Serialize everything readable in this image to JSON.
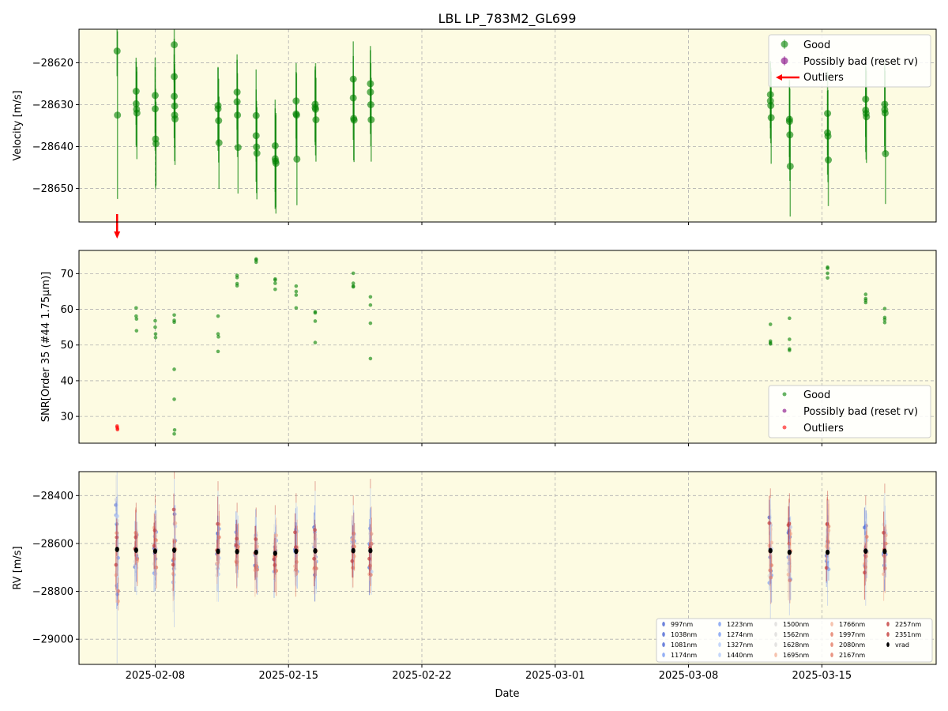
{
  "figure": {
    "title": "LBL LP_783M2_GL699",
    "xlabel": "Date",
    "x_ticks": [
      "2025-02-08",
      "2025-02-15",
      "2025-02-22",
      "2025-03-01",
      "2025-03-08",
      "2025-03-15"
    ],
    "xlim": [
      "2025-02-04",
      "2025-03-21"
    ],
    "background_color": "#fdfbe2",
    "grid": true
  },
  "colors": {
    "good": "#008000",
    "bad": "#800080",
    "outlier": "#ff0000",
    "vrad": "#000000",
    "wavelength_cmap": [
      "#4a65d4",
      "#7b9cf2",
      "#b6cdfa",
      "#dddcdb",
      "#f4b49a",
      "#e47b64",
      "#c33b3a"
    ]
  },
  "chart_data": [
    {
      "type": "scatter",
      "panel": "velocity",
      "ylabel": "Velocity [m/s]",
      "ylim": [
        -28658,
        -28612
      ],
      "yticks": [
        -28620,
        -28630,
        -28640,
        -28650
      ],
      "legend": {
        "placement": "top-right",
        "entries": [
          "Good",
          "Possibly bad (reset rv)",
          "Outliers"
        ]
      },
      "series": [
        {
          "name": "Good",
          "points": [
            {
              "x": "2025-02-06.00",
              "y": -28617.2,
              "err": 6
            },
            {
              "x": "2025-02-06.02",
              "y": -28632.5,
              "err": 20
            },
            {
              "x": "2025-02-07.00",
              "y": -28626.8,
              "err": 8
            },
            {
              "x": "2025-02-07.00",
              "y": -28629.8,
              "err": 10
            },
            {
              "x": "2025-02-07.02",
              "y": -28631.1,
              "err": 9
            },
            {
              "x": "2025-02-07.04",
              "y": -28632.0,
              "err": 11
            },
            {
              "x": "2025-02-08.00",
              "y": -28627.8,
              "err": 9
            },
            {
              "x": "2025-02-08.00",
              "y": -28631.0,
              "err": 10
            },
            {
              "x": "2025-02-08.02",
              "y": -28638.2,
              "err": 12
            },
            {
              "x": "2025-02-08.04",
              "y": -28639.3,
              "err": 10
            },
            {
              "x": "2025-02-09.00",
              "y": -28615.7,
              "err": 9
            },
            {
              "x": "2025-02-09.00",
              "y": -28623.3,
              "err": 9
            },
            {
              "x": "2025-02-09.00",
              "y": -28628.0,
              "err": 10
            },
            {
              "x": "2025-02-09.02",
              "y": -28630.3,
              "err": 10
            },
            {
              "x": "2025-02-09.02",
              "y": -28632.5,
              "err": 11
            },
            {
              "x": "2025-02-09.04",
              "y": -28633.4,
              "err": 11
            },
            {
              "x": "2025-02-11.30",
              "y": -28630.2,
              "err": 9
            },
            {
              "x": "2025-02-11.30",
              "y": -28631.0,
              "err": 10
            },
            {
              "x": "2025-02-11.33",
              "y": -28633.8,
              "err": 10
            },
            {
              "x": "2025-02-11.35",
              "y": -28639.1,
              "err": 11
            },
            {
              "x": "2025-02-12.30",
              "y": -28627.0,
              "err": 9
            },
            {
              "x": "2025-02-12.30",
              "y": -28629.3,
              "err": 10
            },
            {
              "x": "2025-02-12.32",
              "y": -28632.5,
              "err": 10
            },
            {
              "x": "2025-02-12.35",
              "y": -28640.2,
              "err": 11
            },
            {
              "x": "2025-02-13.30",
              "y": -28632.6,
              "err": 11
            },
            {
              "x": "2025-02-13.30",
              "y": -28637.4,
              "err": 11
            },
            {
              "x": "2025-02-13.32",
              "y": -28640.1,
              "err": 11
            },
            {
              "x": "2025-02-13.34",
              "y": -28641.6,
              "err": 11
            },
            {
              "x": "2025-02-14.30",
              "y": -28639.8,
              "err": 11
            },
            {
              "x": "2025-02-14.30",
              "y": -28642.9,
              "err": 12
            },
            {
              "x": "2025-02-14.32",
              "y": -28643.5,
              "err": 11
            },
            {
              "x": "2025-02-14.34",
              "y": -28644.0,
              "err": 12
            },
            {
              "x": "2025-02-15.40",
              "y": -28629.1,
              "err": 9
            },
            {
              "x": "2025-02-15.40",
              "y": -28632.2,
              "err": 10
            },
            {
              "x": "2025-02-15.42",
              "y": -28632.5,
              "err": 10
            },
            {
              "x": "2025-02-15.44",
              "y": -28643.0,
              "err": 11
            },
            {
              "x": "2025-02-16.40",
              "y": -28629.9,
              "err": 9
            },
            {
              "x": "2025-02-16.40",
              "y": -28630.7,
              "err": 9
            },
            {
              "x": "2025-02-16.42",
              "y": -28631.1,
              "err": 11
            },
            {
              "x": "2025-02-16.44",
              "y": -28633.6,
              "err": 10
            },
            {
              "x": "2025-02-18.40",
              "y": -28623.9,
              "err": 9
            },
            {
              "x": "2025-02-18.40",
              "y": -28628.4,
              "err": 10
            },
            {
              "x": "2025-02-18.42",
              "y": -28633.3,
              "err": 10
            },
            {
              "x": "2025-02-18.44",
              "y": -28633.7,
              "err": 10
            },
            {
              "x": "2025-02-19.30",
              "y": -28625.0,
              "err": 9
            },
            {
              "x": "2025-02-19.30",
              "y": -28627.0,
              "err": 10
            },
            {
              "x": "2025-02-19.32",
              "y": -28630.0,
              "err": 10
            },
            {
              "x": "2025-02-19.34",
              "y": -28633.6,
              "err": 10
            },
            {
              "x": "2025-03-12.30",
              "y": -28627.6,
              "err": 8
            },
            {
              "x": "2025-03-12.30",
              "y": -28629.1,
              "err": 9
            },
            {
              "x": "2025-03-12.32",
              "y": -28630.2,
              "err": 9
            },
            {
              "x": "2025-03-12.34",
              "y": -28633.1,
              "err": 11
            },
            {
              "x": "2025-03-13.30",
              "y": -28633.5,
              "err": 9
            },
            {
              "x": "2025-03-13.30",
              "y": -28634.0,
              "err": 10
            },
            {
              "x": "2025-03-13.32",
              "y": -28637.2,
              "err": 11
            },
            {
              "x": "2025-03-13.34",
              "y": -28644.7,
              "err": 12
            },
            {
              "x": "2025-03-15.30",
              "y": -28632.1,
              "err": 10
            },
            {
              "x": "2025-03-15.30",
              "y": -28636.7,
              "err": 10
            },
            {
              "x": "2025-03-15.32",
              "y": -28637.5,
              "err": 11
            },
            {
              "x": "2025-03-15.34",
              "y": -28643.2,
              "err": 11
            },
            {
              "x": "2025-03-17.30",
              "y": -28628.7,
              "err": 9
            },
            {
              "x": "2025-03-17.30",
              "y": -28631.3,
              "err": 10
            },
            {
              "x": "2025-03-17.32",
              "y": -28632.1,
              "err": 11
            },
            {
              "x": "2025-03-17.34",
              "y": -28632.9,
              "err": 11
            },
            {
              "x": "2025-03-18.30",
              "y": -28629.9,
              "err": 10
            },
            {
              "x": "2025-03-18.30",
              "y": -28631.2,
              "err": 10
            },
            {
              "x": "2025-03-18.32",
              "y": -28632.0,
              "err": 10
            },
            {
              "x": "2025-03-18.34",
              "y": -28641.7,
              "err": 12
            }
          ]
        },
        {
          "name": "Possibly bad (reset rv)",
          "points": []
        },
        {
          "name": "Outliers",
          "points": [
            {
              "x": "2025-02-06.00",
              "y": "below axis (off-scale)"
            }
          ]
        }
      ]
    },
    {
      "type": "scatter",
      "panel": "snr",
      "ylabel": "SNR[Order 35 (#44 1.75μm)]",
      "ylim": [
        22.5,
        76.5
      ],
      "yticks": [
        30,
        40,
        50,
        60,
        70
      ],
      "legend": {
        "placement": "bottom-right",
        "entries": [
          "Good",
          "Possibly bad (reset rv)",
          "Outliers"
        ]
      },
      "series": [
        {
          "name": "Good",
          "points": [
            {
              "x": "2025-02-07.00",
              "y": 60.4
            },
            {
              "x": "2025-02-07.00",
              "y": 58.1
            },
            {
              "x": "2025-02-07.02",
              "y": 57.3
            },
            {
              "x": "2025-02-07.02",
              "y": 54.0
            },
            {
              "x": "2025-02-08.00",
              "y": 56.8
            },
            {
              "x": "2025-02-08.00",
              "y": 55.0
            },
            {
              "x": "2025-02-08.02",
              "y": 53.1
            },
            {
              "x": "2025-02-08.02",
              "y": 52.1
            },
            {
              "x": "2025-02-09.00",
              "y": 58.4
            },
            {
              "x": "2025-02-09.00",
              "y": 56.9
            },
            {
              "x": "2025-02-09.00",
              "y": 56.4
            },
            {
              "x": "2025-02-09.00",
              "y": 43.2
            },
            {
              "x": "2025-02-09.00",
              "y": 34.8
            },
            {
              "x": "2025-02-09.02",
              "y": 26.2
            },
            {
              "x": "2025-02-09.00",
              "y": 25.1
            },
            {
              "x": "2025-02-11.30",
              "y": 58.1
            },
            {
              "x": "2025-02-11.30",
              "y": 53.1
            },
            {
              "x": "2025-02-11.32",
              "y": 52.3
            },
            {
              "x": "2025-02-11.30",
              "y": 48.2
            },
            {
              "x": "2025-02-12.30",
              "y": 69.5
            },
            {
              "x": "2025-02-12.30",
              "y": 68.9
            },
            {
              "x": "2025-02-12.30",
              "y": 67.2
            },
            {
              "x": "2025-02-12.30",
              "y": 66.6
            },
            {
              "x": "2025-02-13.30",
              "y": 74.1
            },
            {
              "x": "2025-02-13.30",
              "y": 73.8
            },
            {
              "x": "2025-02-13.30",
              "y": 73.2
            },
            {
              "x": "2025-02-14.30",
              "y": 68.5
            },
            {
              "x": "2025-02-14.30",
              "y": 68.2
            },
            {
              "x": "2025-02-14.30",
              "y": 67.3
            },
            {
              "x": "2025-02-14.30",
              "y": 65.6
            },
            {
              "x": "2025-02-15.40",
              "y": 66.5
            },
            {
              "x": "2025-02-15.40",
              "y": 65.0
            },
            {
              "x": "2025-02-15.40",
              "y": 64.0
            },
            {
              "x": "2025-02-15.40",
              "y": 60.4
            },
            {
              "x": "2025-02-16.40",
              "y": 59.3
            },
            {
              "x": "2025-02-16.40",
              "y": 59.0
            },
            {
              "x": "2025-02-16.40",
              "y": 56.7
            },
            {
              "x": "2025-02-16.40",
              "y": 50.7
            },
            {
              "x": "2025-02-18.40",
              "y": 70.1
            },
            {
              "x": "2025-02-18.40",
              "y": 67.3
            },
            {
              "x": "2025-02-18.40",
              "y": 66.5
            },
            {
              "x": "2025-02-18.40",
              "y": 66.3
            },
            {
              "x": "2025-02-19.30",
              "y": 63.5
            },
            {
              "x": "2025-02-19.30",
              "y": 61.2
            },
            {
              "x": "2025-02-19.30",
              "y": 56.1
            },
            {
              "x": "2025-02-19.30",
              "y": 46.2
            },
            {
              "x": "2025-03-12.30",
              "y": 55.8
            },
            {
              "x": "2025-03-12.30",
              "y": 51.1
            },
            {
              "x": "2025-03-12.30",
              "y": 50.6
            },
            {
              "x": "2025-03-12.30",
              "y": 50.3
            },
            {
              "x": "2025-03-13.30",
              "y": 57.5
            },
            {
              "x": "2025-03-13.30",
              "y": 51.6
            },
            {
              "x": "2025-03-13.30",
              "y": 48.9
            },
            {
              "x": "2025-03-13.30",
              "y": 48.5
            },
            {
              "x": "2025-03-15.30",
              "y": 71.8
            },
            {
              "x": "2025-03-15.30",
              "y": 71.5
            },
            {
              "x": "2025-03-15.30",
              "y": 70.1
            },
            {
              "x": "2025-03-15.30",
              "y": 68.8
            },
            {
              "x": "2025-03-17.30",
              "y": 64.2
            },
            {
              "x": "2025-03-17.30",
              "y": 63.0
            },
            {
              "x": "2025-03-17.30",
              "y": 62.5
            },
            {
              "x": "2025-03-17.30",
              "y": 61.9
            },
            {
              "x": "2025-03-18.30",
              "y": 60.2
            },
            {
              "x": "2025-03-18.30",
              "y": 57.7
            },
            {
              "x": "2025-03-18.30",
              "y": 57.1
            },
            {
              "x": "2025-03-18.30",
              "y": 56.3
            }
          ]
        },
        {
          "name": "Possibly bad (reset rv)",
          "points": []
        },
        {
          "name": "Outliers",
          "points": [
            {
              "x": "2025-02-06.00",
              "y": 27.3
            },
            {
              "x": "2025-02-06.00",
              "y": 27.0
            },
            {
              "x": "2025-02-06.02",
              "y": 26.6
            },
            {
              "x": "2025-02-06.02",
              "y": 26.3
            }
          ]
        }
      ]
    },
    {
      "type": "scatter",
      "panel": "rv_per_band",
      "ylabel": "RV [m/s]",
      "ylim": [
        -29105,
        -28300
      ],
      "yticks": [
        -28400,
        -28600,
        -28800,
        -29000
      ],
      "legend": {
        "placement": "bottom-right",
        "entries": [
          "997nm",
          "1038nm",
          "1081nm",
          "1174nm",
          "1223nm",
          "1274nm",
          "1327nm",
          "1440nm",
          "1500nm",
          "1562nm",
          "1628nm",
          "1695nm",
          "1766nm",
          "1997nm",
          "2080nm",
          "2167nm",
          "2257nm",
          "2351nm",
          "vrad"
        ]
      },
      "epochs": [
        "2025-02-06.00",
        "2025-02-07.00",
        "2025-02-08.00",
        "2025-02-09.00",
        "2025-02-11.30",
        "2025-02-12.30",
        "2025-02-13.30",
        "2025-02-14.30",
        "2025-02-15.40",
        "2025-02-16.40",
        "2025-02-18.40",
        "2025-02-19.30",
        "2025-03-12.30",
        "2025-03-13.30",
        "2025-03-15.30",
        "2025-03-17.30",
        "2025-03-18.30"
      ],
      "vrad": [
        -28625,
        -28628,
        -28632,
        -28628,
        -28633,
        -28634,
        -28637,
        -28641,
        -28633,
        -28631,
        -28630,
        -28630,
        -28630,
        -28637,
        -28637,
        -28632,
        -28633
      ],
      "band_spread_low": [
        -29100,
        -28760,
        -28800,
        -28950,
        -28800,
        -28780,
        -28790,
        -28760,
        -28780,
        -28760,
        -28740,
        -28770,
        -28920,
        -28900,
        -28860,
        -28860,
        -28800
      ],
      "band_spread_high": [
        -28300,
        -28470,
        -28440,
        -28330,
        -28380,
        -28470,
        -28490,
        -28480,
        -28430,
        -28380,
        -28440,
        -28370,
        -28410,
        -28430,
        -28420,
        -28440,
        -28390
      ]
    }
  ],
  "annotations": {
    "outlier_arrow": "2025-02-06.00"
  }
}
